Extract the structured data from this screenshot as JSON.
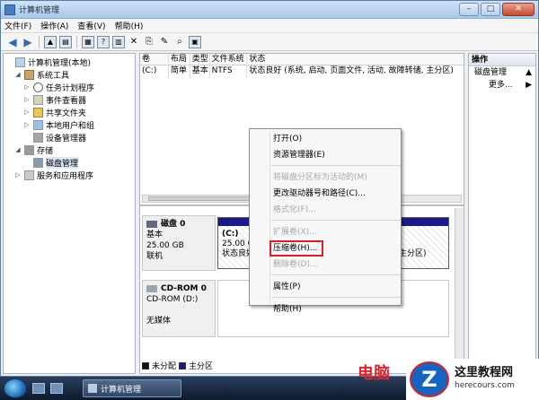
{
  "window": {
    "title": "计算机管理",
    "buttons": {
      "minimize": "–",
      "maximize": "□",
      "close": "✕"
    }
  },
  "menubar": [
    "文件(F)",
    "操作(A)",
    "查看(V)",
    "帮助(H)"
  ],
  "toolbar": [
    "back-arrow-icon",
    "forward-arrow-icon",
    "up-folder-icon",
    "show-hide-tree-icon",
    "properties-icon",
    "help-icon",
    "refresh-icon",
    "delete-icon",
    "open-icon",
    "new-icon",
    "search-icon",
    "disk-icon"
  ],
  "tree": [
    {
      "label": "计算机管理(本地)",
      "level": 0,
      "exp": ""
    },
    {
      "label": "系统工具",
      "level": 1,
      "exp": "◢"
    },
    {
      "label": "任务计划程序",
      "level": 2,
      "exp": "▷"
    },
    {
      "label": "事件查看器",
      "level": 2,
      "exp": "▷"
    },
    {
      "label": "共享文件夹",
      "level": 2,
      "exp": "▷"
    },
    {
      "label": "本地用户和组",
      "level": 2,
      "exp": "▷"
    },
    {
      "label": "设备管理器",
      "level": 2,
      "exp": ""
    },
    {
      "label": "存储",
      "level": 1,
      "exp": "◢"
    },
    {
      "label": "磁盘管理",
      "level": 2,
      "exp": ""
    },
    {
      "label": "服务和应用程序",
      "level": 1,
      "exp": "▷"
    }
  ],
  "volumes": {
    "headers": [
      "卷",
      "布局",
      "类型",
      "文件系统",
      "状态"
    ],
    "rows": [
      [
        "(C:)",
        "简单",
        "基本",
        "NTFS",
        "状态良好 (系统, 启动, 页面文件, 活动, 故障转储, 主分区)"
      ]
    ]
  },
  "disks": {
    "disk0": {
      "name": "磁盘 0",
      "type": "基本",
      "size": "25.00 GB",
      "status": "联机",
      "partition": {
        "label": "(C:)",
        "size": "25.00 GB NTFS",
        "status": "状态良好 (系统, 启动, 页面文件, 活动, 故障转储, 主分区)"
      }
    },
    "cdrom0": {
      "name": "CD-ROM 0",
      "drive": "CD-ROM (D:)",
      "status": "无媒体"
    }
  },
  "legend": {
    "unallocated": "未分配",
    "primary": "主分区"
  },
  "actions": {
    "header": "操作",
    "section": "磁盘管理",
    "more": "更多..."
  },
  "context_menu": [
    {
      "label": "打开(O)",
      "disabled": false
    },
    {
      "label": "资源管理器(E)",
      "disabled": false
    },
    {
      "sep": true
    },
    {
      "label": "将磁盘分区标为活动的(M)",
      "disabled": true
    },
    {
      "label": "更改驱动器号和路径(C)...",
      "disabled": false
    },
    {
      "label": "格式化(F)...",
      "disabled": true
    },
    {
      "sep": true
    },
    {
      "label": "扩展卷(X)...",
      "disabled": true
    },
    {
      "label": "压缩卷(H)...",
      "disabled": false,
      "highlight": true
    },
    {
      "label": "删除卷(D)...",
      "disabled": true
    },
    {
      "sep": true
    },
    {
      "label": "属性(P)",
      "disabled": false
    },
    {
      "sep": true
    },
    {
      "label": "帮助(H)",
      "disabled": false
    }
  ],
  "taskbar": {
    "task_label": "计算机管理"
  },
  "watermark": {
    "red_text": "电脑",
    "logo_letter": "Z",
    "site_name": "这里教程网",
    "site_url": "herecours.com"
  },
  "colors": {
    "primary_partition": "#1a1a88",
    "highlight_outline": "#d8202a"
  }
}
